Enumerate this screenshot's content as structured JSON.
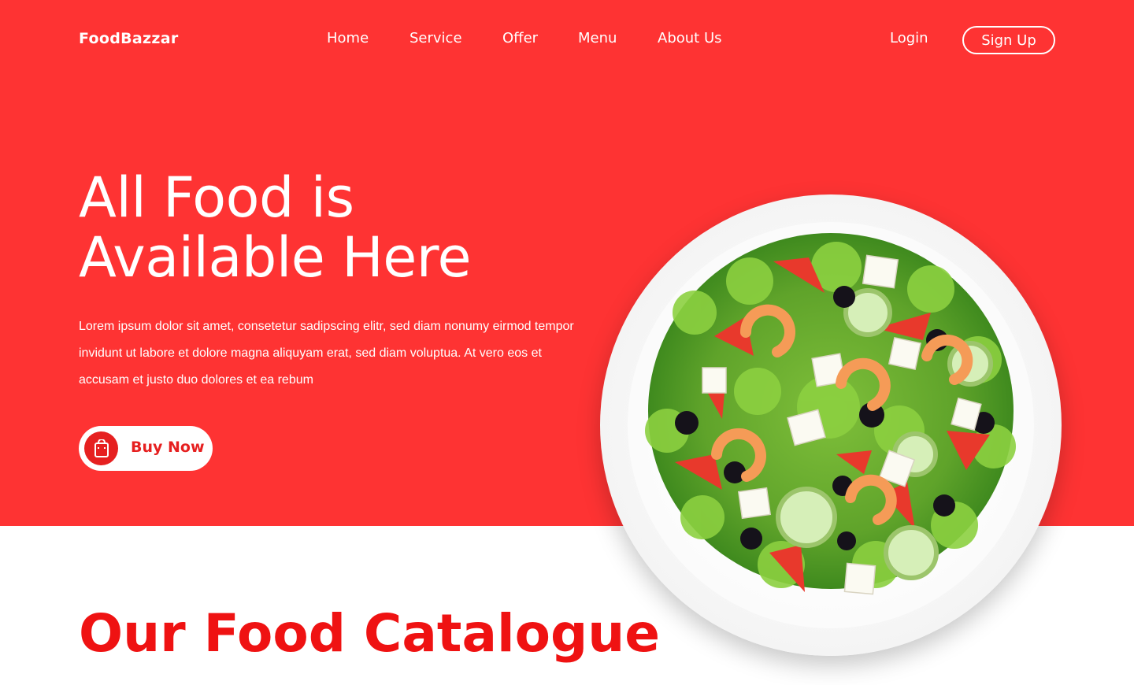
{
  "brand": {
    "logo": "FoodBazzar"
  },
  "nav": {
    "items": [
      {
        "label": "Home"
      },
      {
        "label": "Service"
      },
      {
        "label": "Offer"
      },
      {
        "label": "Menu"
      },
      {
        "label": "About Us"
      }
    ],
    "login": "Login",
    "signup": "Sign Up"
  },
  "hero": {
    "title_line1": "All Food is",
    "title_line2": "Available Here",
    "description": "Lorem ipsum dolor sit amet, consetetur sadipscing elitr, sed diam nonumy eirmod tempor invidunt ut labore et dolore magna aliquyam erat, sed diam voluptua. At vero eos et accusam et justo duo dolores et ea rebum",
    "cta": {
      "label": "Buy Now",
      "icon": "shopping-bag-icon"
    },
    "image": "salad-plate-image"
  },
  "catalogue": {
    "title": "Our Food Catalogue"
  },
  "colors": {
    "primary": "#fe3333",
    "accent": "#e62020",
    "text_on_primary": "#ffffff"
  }
}
